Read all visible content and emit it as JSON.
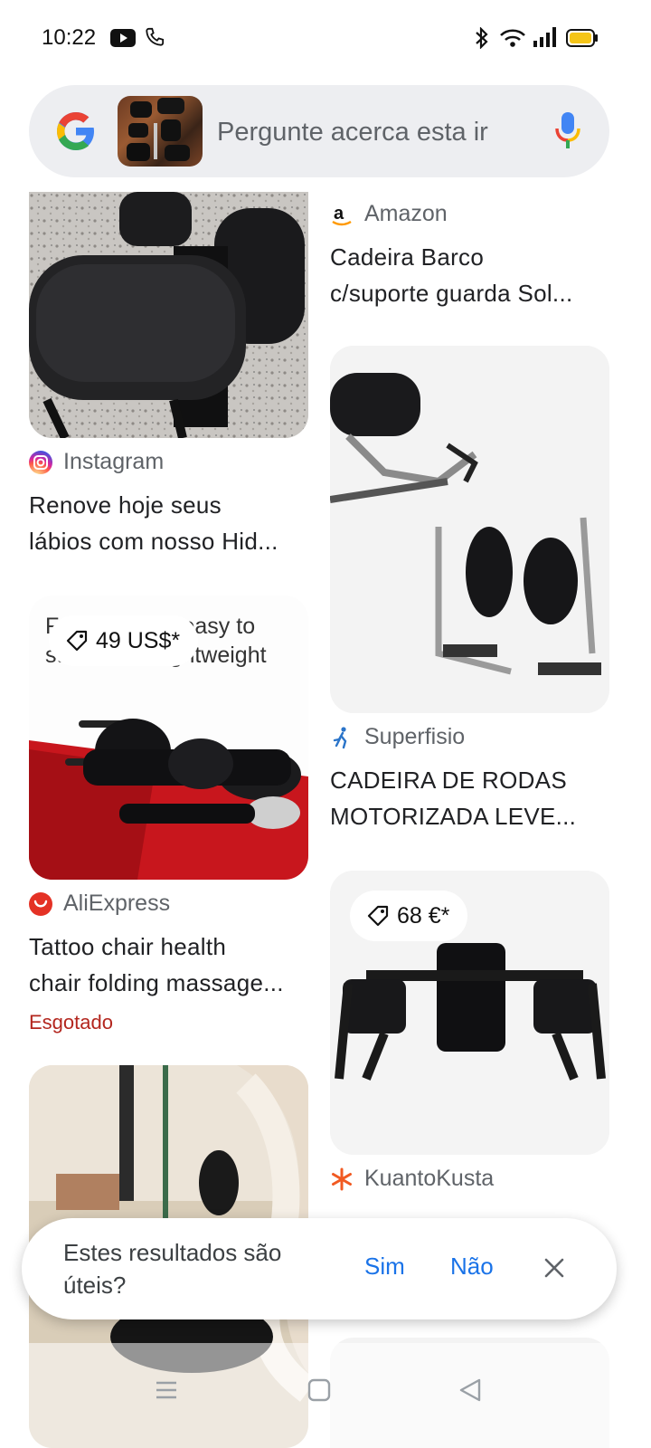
{
  "status_bar": {
    "time": "10:22"
  },
  "search": {
    "placeholder": "Pergunte acerca esta ir"
  },
  "results": {
    "left": [
      {
        "source": "Instagram",
        "title_line1": "Renove hoje seus",
        "title_line2": "lábios com nosso Hid..."
      },
      {
        "price": "49 US$*",
        "overlay_text1": "Foldable and easy to",
        "overlay_text2": "store more lightweight",
        "source": "AliExpress",
        "title_line1": "Tattoo chair health",
        "title_line2": "chair folding massage...",
        "stock": "Esgotado"
      },
      {
        "source": ""
      }
    ],
    "right": [
      {
        "source": "Amazon",
        "title_line1": "Cadeira Barco",
        "title_line2": "c/suporte guarda Sol..."
      },
      {
        "source": "Superfisio",
        "title_line1": "CADEIRA DE RODAS",
        "title_line2": "MOTORIZADA LEVE..."
      },
      {
        "price": "68 €*",
        "source": "KuantoKusta"
      }
    ]
  },
  "feedback": {
    "question": "Estes resultados são úteis?",
    "yes": "Sim",
    "no": "Não"
  },
  "colors": {
    "accent_blue": "#1a73e8",
    "out_of_stock_red": "#b3261e",
    "search_bg": "#edeef1"
  }
}
